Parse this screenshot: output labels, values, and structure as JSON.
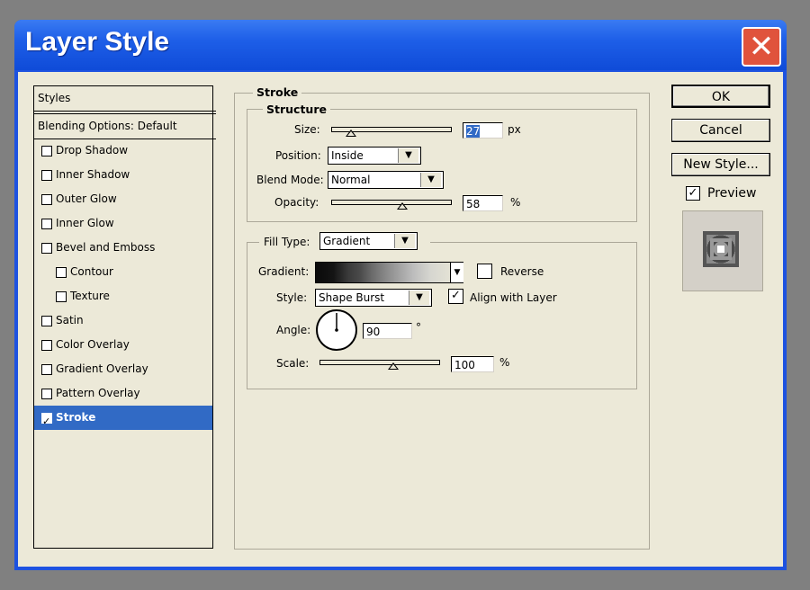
{
  "window": {
    "title": "Layer Style",
    "close_glyph": "✕"
  },
  "styles_panel": {
    "header": "Styles",
    "blending": "Blending Options: Default",
    "items": [
      {
        "label": "Drop Shadow",
        "checked": false,
        "indent": false,
        "selected": false
      },
      {
        "label": "Inner Shadow",
        "checked": false,
        "indent": false,
        "selected": false
      },
      {
        "label": "Outer Glow",
        "checked": false,
        "indent": false,
        "selected": false
      },
      {
        "label": "Inner Glow",
        "checked": false,
        "indent": false,
        "selected": false
      },
      {
        "label": "Bevel and Emboss",
        "checked": false,
        "indent": false,
        "selected": false
      },
      {
        "label": "Contour",
        "checked": false,
        "indent": true,
        "selected": false
      },
      {
        "label": "Texture",
        "checked": false,
        "indent": true,
        "selected": false
      },
      {
        "label": "Satin",
        "checked": false,
        "indent": false,
        "selected": false
      },
      {
        "label": "Color Overlay",
        "checked": false,
        "indent": false,
        "selected": false
      },
      {
        "label": "Gradient Overlay",
        "checked": false,
        "indent": false,
        "selected": false
      },
      {
        "label": "Pattern Overlay",
        "checked": false,
        "indent": false,
        "selected": false
      },
      {
        "label": "Stroke",
        "checked": true,
        "indent": false,
        "selected": true
      }
    ]
  },
  "stroke": {
    "group_title": "Stroke",
    "structure": {
      "title": "Structure",
      "size_label": "Size:",
      "size_value": "27",
      "size_unit": "px",
      "position_label": "Position:",
      "position_value": "Inside",
      "blend_label": "Blend Mode:",
      "blend_value": "Normal",
      "opacity_label": "Opacity:",
      "opacity_value": "58",
      "opacity_unit": "%"
    },
    "fill": {
      "fill_type_label": "Fill Type:",
      "fill_type_value": "Gradient",
      "gradient_label": "Gradient:",
      "reverse_label": "Reverse",
      "reverse_checked": false,
      "style_label": "Style:",
      "style_value": "Shape Burst",
      "align_label": "Align with Layer",
      "align_checked": true,
      "angle_label": "Angle:",
      "angle_value": "90",
      "angle_unit": "°",
      "scale_label": "Scale:",
      "scale_value": "100",
      "scale_unit": "%"
    }
  },
  "buttons": {
    "ok": "OK",
    "cancel": "Cancel",
    "new_style": "New Style...",
    "preview_label": "Preview",
    "preview_checked": true
  },
  "colors": {
    "title_bar": "#1e5fe8",
    "dialog_bg": "#ece9d8",
    "selection": "#316ac5",
    "close": "#e0533c"
  }
}
